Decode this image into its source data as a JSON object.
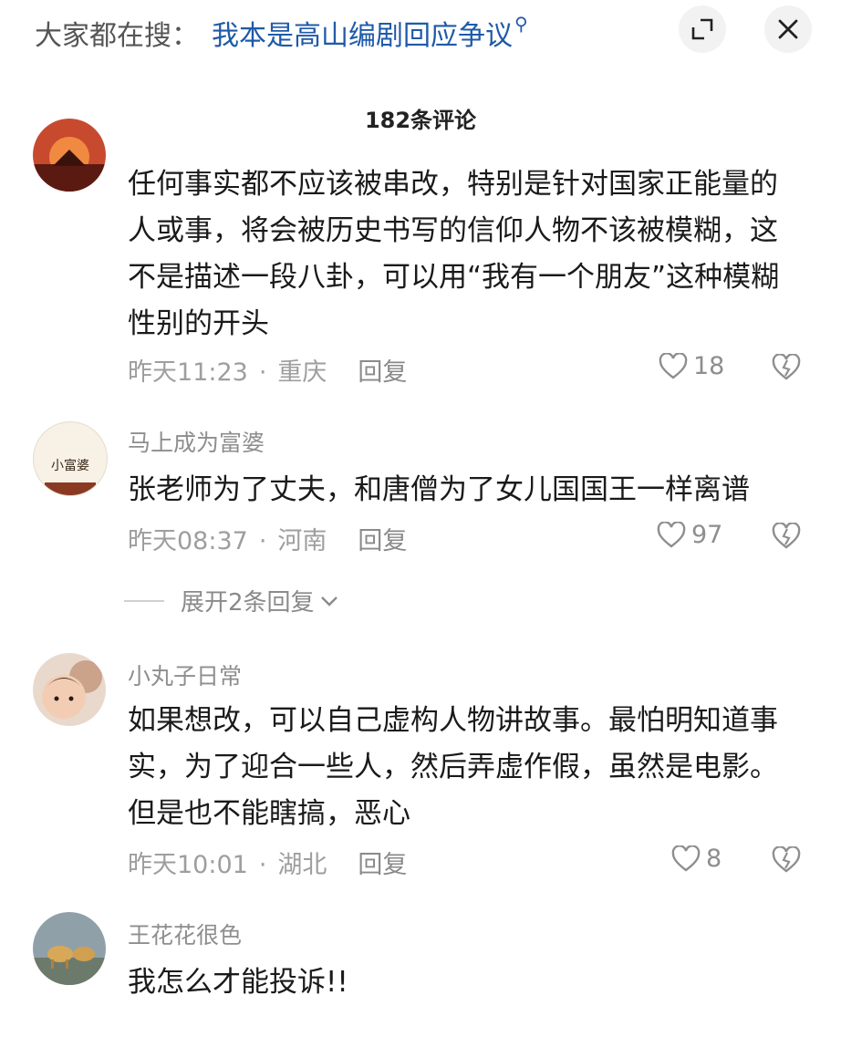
{
  "search": {
    "prefix": "大家都在搜：",
    "query": "我本是高山编剧回应争议"
  },
  "header": {
    "comment_count": "182条评论"
  },
  "comments": [
    {
      "username": "",
      "text": "任何事实都不应该被串改，特别是针对国家正能量的人或事，将会被历史书写的信仰人物不该被模糊，这不是描述一段八卦，可以用“我有一个朋友”这种模糊性别的开头",
      "time": "昨天11:23",
      "location": "重庆",
      "reply_label": "回复",
      "likes": "18"
    },
    {
      "username": "马上成为富婆",
      "text": "张老师为了丈夫，和唐僧为了女儿国国王一样离谱",
      "time": "昨天08:37",
      "location": "河南",
      "reply_label": "回复",
      "likes": "97",
      "expand_label": "展开2条回复",
      "avatar_text": "小富婆"
    },
    {
      "username": "小丸子日常",
      "text": "如果想改，可以自己虚构人物讲故事。最怕明知道事实，为了迎合一些人，然后弄虚作假，虽然是电影。但是也不能瞎搞，恶心",
      "time": "昨天10:01",
      "location": "湖北",
      "reply_label": "回复",
      "likes": "8"
    },
    {
      "username": "王花花很色",
      "text": "我怎么才能投诉!!",
      "time": "",
      "location": "",
      "reply_label": "",
      "likes": ""
    }
  ],
  "colors": {
    "link": "#1f5aa8",
    "muted": "#9e9e9e"
  },
  "icons": [
    "expand-icon",
    "close-icon",
    "search-icon",
    "heart-icon",
    "dislike-heart-icon",
    "chevron-down-icon"
  ]
}
